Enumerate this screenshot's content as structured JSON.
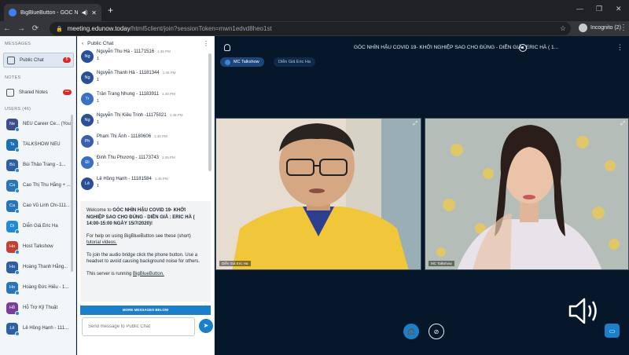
{
  "browser": {
    "tab_title": "BigBlueButton - GÓC NHÌN",
    "url_host": "meeting.edunow.today",
    "url_path": "/html5client/join?sessionToken=mwn1edvd8heo1st",
    "incognito": "Incognito (2)"
  },
  "sidebar": {
    "messages_title": "MESSAGES",
    "public_chat": "Public Chat",
    "public_chat_badge": "5",
    "notes_title": "NOTES",
    "shared_notes": "Shared Notes",
    "users_title": "USERS (46)",
    "users": [
      {
        "initials": "Ne",
        "name": "NEU Career Ce... (You)",
        "color": "#3b4d8a"
      },
      {
        "initials": "Ta",
        "name": "TALKSHOW NEU",
        "color": "#1c6fb3"
      },
      {
        "initials": "Bù",
        "name": "Bùi Thảo Trang - 1...",
        "color": "#2d5fa3"
      },
      {
        "initials": "Ca",
        "name": "Cao Thị Thu Hằng + ...",
        "color": "#2a74b8"
      },
      {
        "initials": "Ca",
        "name": "Cao Vũ Linh Chi-111...",
        "color": "#2a74b8"
      },
      {
        "initials": "Di",
        "name": "Diễn Giả Eric Ha",
        "color": "#1f8bd6"
      },
      {
        "initials": "Ho",
        "name": "Host Talkshow",
        "color": "#c5402f"
      },
      {
        "initials": "Ho",
        "name": "Hoàng Thanh Hằng...",
        "color": "#2d5fa3"
      },
      {
        "initials": "Ho",
        "name": "Hoàng Đức Hiếu - 1...",
        "color": "#2a74b8"
      },
      {
        "initials": "Hỗ",
        "name": "Hỗ Trợ Kỹ Thuật",
        "color": "#7a3d99"
      },
      {
        "initials": "Lê",
        "name": "Lê Hồng Hạnh - 111...",
        "color": "#2d5fa3"
      }
    ]
  },
  "chat": {
    "header": "Public Chat",
    "messages": [
      {
        "initials": "Ng",
        "name": "Nguyễn Thu Hà - 11171516",
        "time": "1:45 PM",
        "text": "1",
        "color": "#2a4f9a"
      },
      {
        "initials": "Ng",
        "name": "Nguyễn Thanh Hà - 11181344",
        "time": "1:45 PM",
        "text": "1",
        "color": "#2a4f9a"
      },
      {
        "initials": "Tr",
        "name": "Trần Trang Nhung - 11183911",
        "time": "1:45 PM",
        "text": "1",
        "color": "#3a6fc1"
      },
      {
        "initials": "Ng",
        "name": "Nguyễn Thị Kiều Trinh -11175021",
        "time": "1:45 PM",
        "text": "1",
        "color": "#2a4f9a"
      },
      {
        "initials": "Ph",
        "name": "Phạm Thị Ánh - 11180606",
        "time": "1:45 PM",
        "text": "1",
        "color": "#3a5fae"
      },
      {
        "initials": "Đi",
        "name": "Đinh Thu Phương - 11173743",
        "time": "1:45 PM",
        "text": "1",
        "color": "#3a6fc1"
      },
      {
        "initials": "Lê",
        "name": "Lê Hồng Hạnh - 11181584",
        "time": "1:45 PM",
        "text": "1",
        "color": "#2a4f9a"
      }
    ],
    "welcome_prefix": "Welcome to ",
    "welcome_bold": "GÓC NHÌN HẬU COVID 19- KHỞI NGHIỆP SAO CHO ĐÚNG - DIỄN GIẢ : ERIC HÀ ( 14:00-15:00 NGÀY 15/7/2020)!",
    "help_prefix": "For help on using BigBlueButton see these (short) ",
    "help_link": "tutorial videos.",
    "audio_text": "To join the audio bridge click the phone button. Use a headset to avoid causing background noise for others.",
    "server_prefix": "This server is running ",
    "server_link": "BigBlueButton.",
    "more_messages": "MORE MESSAGES BELOW",
    "input_placeholder": "Send message to Public Chat"
  },
  "stage": {
    "title": "GÓC NHÌN HẬU COVID 19- KHỞI NGHIỆP SAO CHO ĐÚNG - DIỄN GIẢ : ERIC HÀ ( 1...",
    "talker_1": "MC Talkshow",
    "talker_2": "Diễn Giả Eric Ha",
    "video_left_label": "Diễn Giả Eric Ha",
    "video_right_label": "MC Talkshow"
  }
}
